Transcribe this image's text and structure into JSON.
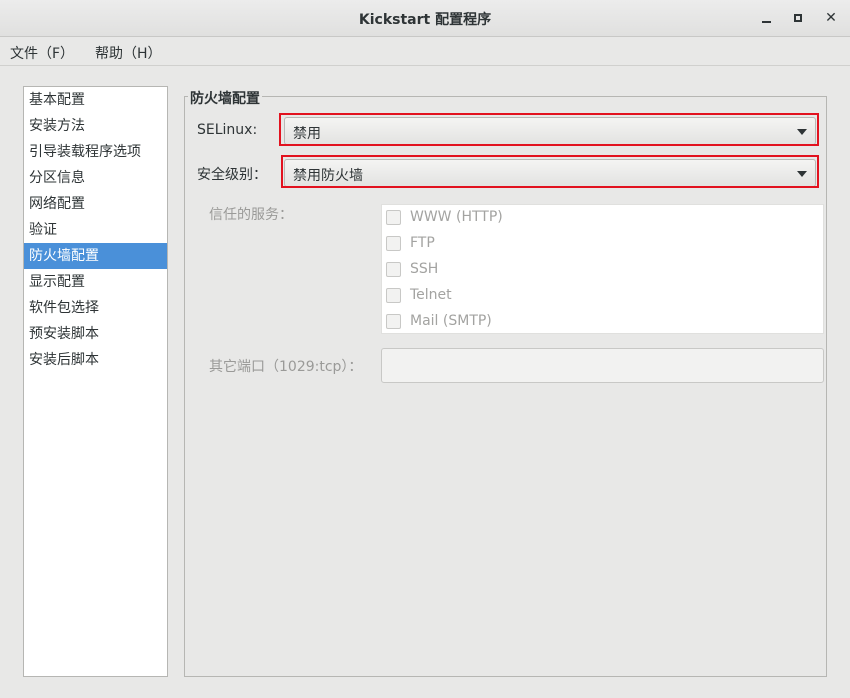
{
  "window": {
    "title": "Kickstart 配置程序",
    "minimize_label": "",
    "close_glyph": "✕"
  },
  "menubar": {
    "items": [
      "文件（F）",
      "帮助（H）"
    ]
  },
  "sidebar": {
    "items": [
      {
        "label": "基本配置"
      },
      {
        "label": "安装方法"
      },
      {
        "label": "引导装载程序选项"
      },
      {
        "label": "分区信息"
      },
      {
        "label": "网络配置"
      },
      {
        "label": "验证"
      },
      {
        "label": "防火墙配置",
        "selected": true
      },
      {
        "label": "显示配置"
      },
      {
        "label": "软件包选择"
      },
      {
        "label": "预安装脚本"
      },
      {
        "label": "安装后脚本"
      }
    ]
  },
  "firewall": {
    "section_title": "防火墙配置",
    "selinux": {
      "label": "SELinux:",
      "value": "禁用"
    },
    "security_level": {
      "label": "安全级别：",
      "value": "禁用防火墙"
    },
    "trusted_services": {
      "label": "信任的服务：",
      "items": [
        "WWW (HTTP)",
        "FTP",
        "SSH",
        "Telnet",
        "Mail (SMTP)"
      ]
    },
    "other_ports": {
      "label": "其它端口（1029:tcp）：",
      "value": ""
    }
  },
  "colors": {
    "highlight": "#e2121f",
    "selection": "#4a90d9"
  }
}
